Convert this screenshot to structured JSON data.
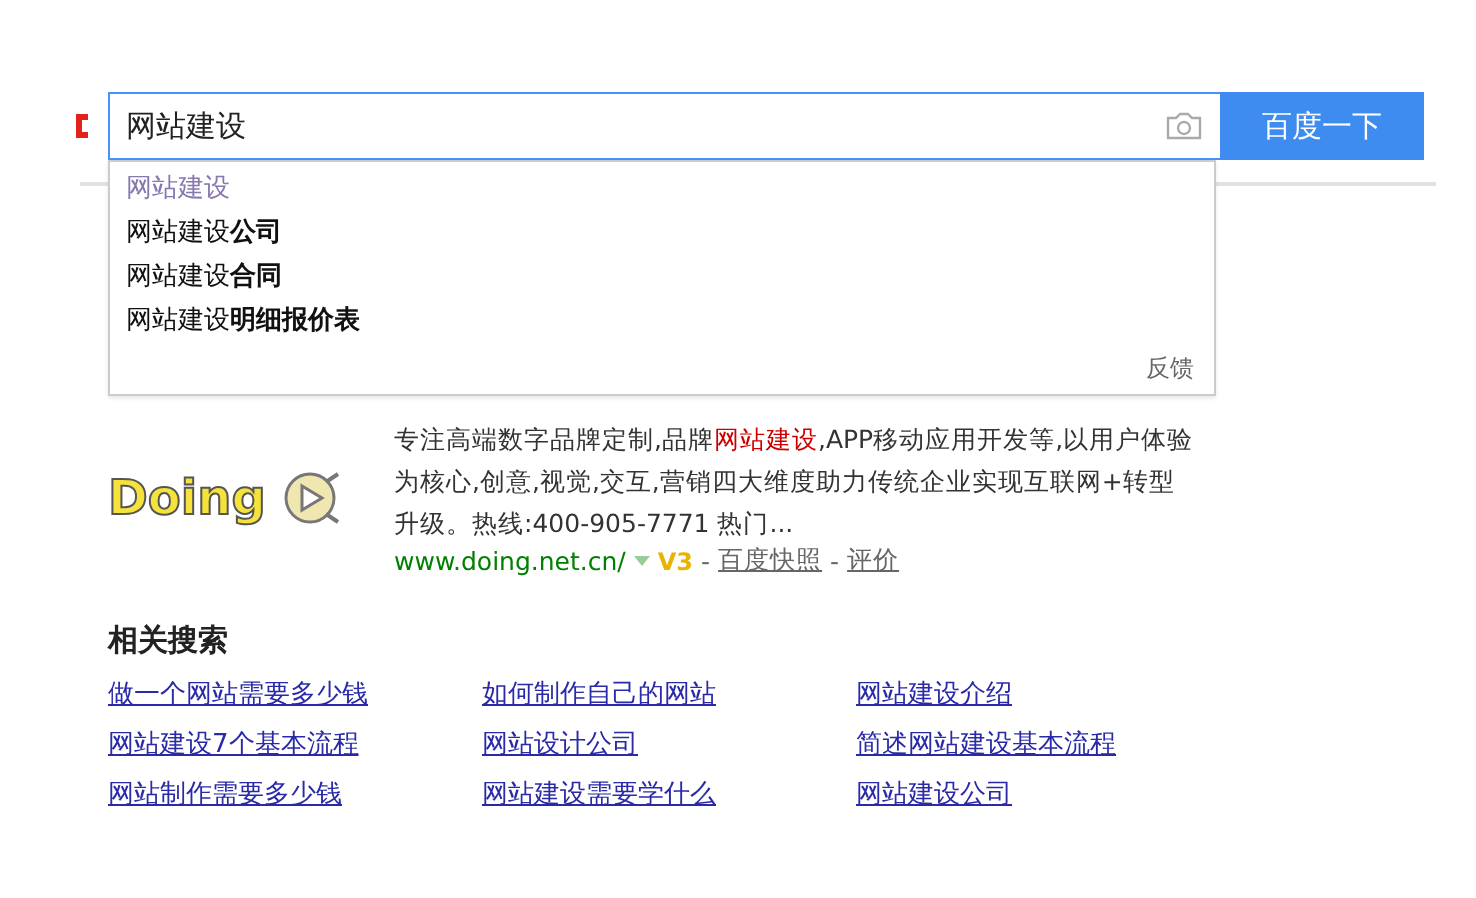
{
  "search": {
    "value": "网站建设",
    "button": "百度一下"
  },
  "suggestions": [
    {
      "kind": "history",
      "text": "网站建设"
    },
    {
      "kind": "suggestion",
      "text": "网站建设**公司**"
    },
    {
      "kind": "suggestion",
      "text": "网站建设**合同**"
    },
    {
      "kind": "suggestion",
      "text": "网站建设**明细报价表**"
    }
  ],
  "feedback": "反馈",
  "result": {
    "description": [
      {
        "text": "专注高端数字品牌定制,品牌",
        "highlight": false
      },
      {
        "text": "网站建设",
        "highlight": true
      },
      {
        "text": ",APP移动应用开发等,以用户体验为核心,创意,视觉,交互,营销四大维度助力传统企业实现互联网+转型升级。热线:400-905-7771 热门...",
        "highlight": false
      }
    ],
    "logo_text": "Doing",
    "url": "www.doing.net.cn/",
    "badge": "V3",
    "links": [
      {
        "separator": "-",
        "text": "百度快照"
      },
      {
        "separator": "-",
        "text": "评价"
      }
    ]
  },
  "related": {
    "title": "相关搜索",
    "items": [
      "做一个网站需要多少钱",
      "如何制作自己的网站",
      "网站建设介绍",
      "网站建设7个基本流程",
      "网站设计公司",
      "简述网站建设基本流程",
      "网站制作需要多少钱",
      "网站建设需要学什么",
      "网站建设公司"
    ]
  }
}
